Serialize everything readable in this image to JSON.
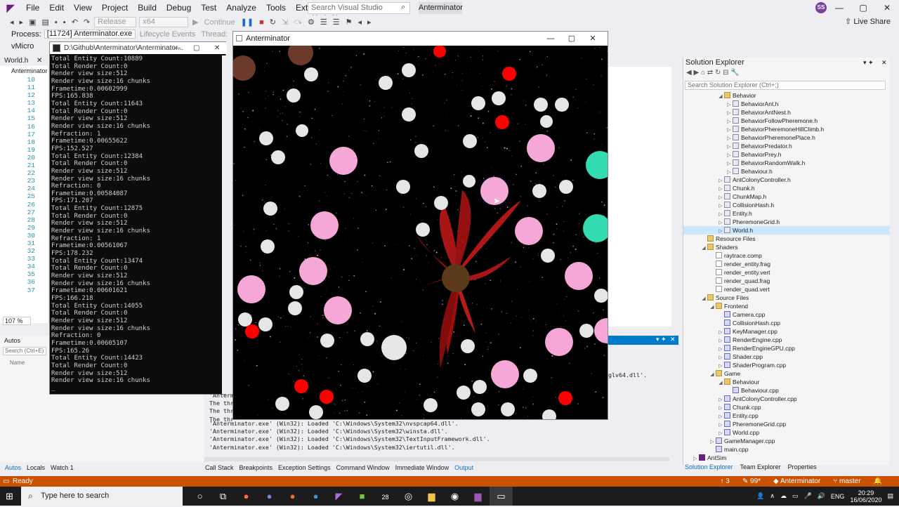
{
  "menu": {
    "items": [
      "File",
      "Edit",
      "View",
      "Project",
      "Build",
      "Debug",
      "Test",
      "Analyze",
      "Tools",
      "Extensions",
      "Window",
      "Help"
    ],
    "search_placeholder": "Search Visual Studio (Ctrl+Q)",
    "solution_name": "Anterminator",
    "avatar_initials": "SS"
  },
  "toolbar": {
    "config": "Release",
    "platform": "x64",
    "continue": "Continue",
    "live_share": "Live Share"
  },
  "process_bar": {
    "process_label": "Process:",
    "process_value": "[11724] Anterminator.exe",
    "lifecycle": "Lifecycle Events",
    "thread": "Thread:"
  },
  "editor": {
    "tab_micro": "vMicro",
    "file_tab": "World.h",
    "scope": "Anterminator",
    "line_numbers": [
      "10",
      "11",
      "12",
      "13",
      "14",
      "15",
      "16",
      "17",
      "18",
      "19",
      "20",
      "21",
      "22",
      "23",
      "24",
      "25",
      "26",
      "27",
      "28",
      "29",
      "30",
      "31",
      "32",
      "33",
      "34",
      "35",
      "36",
      "37"
    ],
    "zoom": "107 %"
  },
  "console": {
    "title": "D:\\Github\\Anterminator\\Anterminator...",
    "lines": [
      "Total Entity Count:10889",
      "Total Render Count:0",
      "Render view size:512",
      "Render view size:16 chunks",
      "Frametime:0.00602999",
      "FPS:165.838",
      "Total Entity Count:11643",
      "Total Render Count:0",
      "Render view size:512",
      "Render view size:16 chunks",
      "Refraction: 1",
      "Frametime:0.00655622",
      "FPS:152.527",
      "Total Entity Count:12384",
      "Total Render Count:0",
      "Render view size:512",
      "Render view size:16 chunks",
      "Refraction: 0",
      "Frametime:0.00584087",
      "FPS:171.207",
      "Total Entity Count:12875",
      "Total Render Count:0",
      "Render view size:512",
      "Render view size:16 chunks",
      "Refraction: 1",
      "Frametime:0.00561067",
      "FPS:178.232",
      "Total Entity Count:13474",
      "Total Render Count:0",
      "Render view size:512",
      "Render view size:16 chunks",
      "Frametime:0.00601621",
      "FPS:166.218",
      "Total Entity Count:14055",
      "Total Render Count:0",
      "Render view size:512",
      "Render view size:16 chunks",
      "Refraction: 0",
      "Frametime:0.00605107",
      "FPS:165.26",
      "Total Entity Count:14423",
      "Total Render Count:0",
      "Render view size:512",
      "Render view size:16 chunks"
    ]
  },
  "game_window": {
    "title": "Anterminator"
  },
  "autos": {
    "title": "Autos",
    "search": "Search (Ctrl+E)",
    "col_name": "Name"
  },
  "solution_explorer": {
    "title": "Solution Explorer",
    "search": "Search Solution Explorer (Ctrl+;)",
    "tree": [
      {
        "label": "Behavior",
        "kind": "fold",
        "indent": 4,
        "exp": "◢"
      },
      {
        "label": "BehaviorAnt.h",
        "kind": "h",
        "indent": 5,
        "exp": "▷"
      },
      {
        "label": "BehaviorAntNest.h",
        "kind": "h",
        "indent": 5,
        "exp": "▷"
      },
      {
        "label": "BehaviorFollowPheremone.h",
        "kind": "h",
        "indent": 5,
        "exp": "▷"
      },
      {
        "label": "BehaviorPheremoneHillClimb.h",
        "kind": "h",
        "indent": 5,
        "exp": "▷"
      },
      {
        "label": "BehaviorPheremonePlace.h",
        "kind": "h",
        "indent": 5,
        "exp": "▷"
      },
      {
        "label": "BehaviorPredator.h",
        "kind": "h",
        "indent": 5,
        "exp": "▷"
      },
      {
        "label": "BehaviorPrey.h",
        "kind": "h",
        "indent": 5,
        "exp": "▷"
      },
      {
        "label": "BehaviorRandomWalk.h",
        "kind": "h",
        "indent": 5,
        "exp": "▷"
      },
      {
        "label": "Behaviour.h",
        "kind": "h",
        "indent": 5,
        "exp": "▷"
      },
      {
        "label": "AntColonyController.h",
        "kind": "h",
        "indent": 4,
        "exp": "▷"
      },
      {
        "label": "Chunk.h",
        "kind": "h",
        "indent": 4,
        "exp": "▷"
      },
      {
        "label": "ChunkMap.h",
        "kind": "h",
        "indent": 4,
        "exp": "▷"
      },
      {
        "label": "CollisionHash.h",
        "kind": "h",
        "indent": 4,
        "exp": "▷"
      },
      {
        "label": "Entity.h",
        "kind": "h",
        "indent": 4,
        "exp": "▷"
      },
      {
        "label": "PheremoneGrid.h",
        "kind": "h",
        "indent": 4,
        "exp": "▷"
      },
      {
        "label": "World.h",
        "kind": "h",
        "indent": 4,
        "exp": "▷",
        "sel": true
      },
      {
        "label": "Resource Files",
        "kind": "fold",
        "indent": 2,
        "exp": ""
      },
      {
        "label": "Shaders",
        "kind": "fold",
        "indent": 2,
        "exp": "◢"
      },
      {
        "label": "raytrace.comp",
        "kind": "sh",
        "indent": 3,
        "exp": ""
      },
      {
        "label": "render_entity.frag",
        "kind": "sh",
        "indent": 3,
        "exp": ""
      },
      {
        "label": "render_entity.vert",
        "kind": "sh",
        "indent": 3,
        "exp": ""
      },
      {
        "label": "render_quad.frag",
        "kind": "sh",
        "indent": 3,
        "exp": ""
      },
      {
        "label": "render_quad.vert",
        "kind": "sh",
        "indent": 3,
        "exp": ""
      },
      {
        "label": "Source Files",
        "kind": "fold",
        "indent": 2,
        "exp": "◢"
      },
      {
        "label": "Frontend",
        "kind": "fold",
        "indent": 3,
        "exp": "◢"
      },
      {
        "label": "Camera.cpp",
        "kind": "cpp",
        "indent": 4,
        "exp": ""
      },
      {
        "label": "CollisionHash.cpp",
        "kind": "cpp",
        "indent": 4,
        "exp": ""
      },
      {
        "label": "KeyManager.cpp",
        "kind": "cpp",
        "indent": 4,
        "exp": "▷"
      },
      {
        "label": "RenderEngine.cpp",
        "kind": "cpp",
        "indent": 4,
        "exp": "▷"
      },
      {
        "label": "RenderEngineGPU.cpp",
        "kind": "cpp",
        "indent": 4,
        "exp": "▷"
      },
      {
        "label": "Shader.cpp",
        "kind": "cpp",
        "indent": 4,
        "exp": "▷"
      },
      {
        "label": "ShaderProgram.cpp",
        "kind": "cpp",
        "indent": 4,
        "exp": "▷"
      },
      {
        "label": "Game",
        "kind": "fold",
        "indent": 3,
        "exp": "◢"
      },
      {
        "label": "Behaviour",
        "kind": "fold",
        "indent": 4,
        "exp": "◢"
      },
      {
        "label": "Behaviour.cpp",
        "kind": "cpp",
        "indent": 5,
        "exp": ""
      },
      {
        "label": "AntColonyController.cpp",
        "kind": "cpp",
        "indent": 4,
        "exp": "▷"
      },
      {
        "label": "Chunk.cpp",
        "kind": "cpp",
        "indent": 4,
        "exp": "▷"
      },
      {
        "label": "Entity.cpp",
        "kind": "cpp",
        "indent": 4,
        "exp": "▷"
      },
      {
        "label": "PheremoneGrid.cpp",
        "kind": "cpp",
        "indent": 4,
        "exp": "▷"
      },
      {
        "label": "World.cpp",
        "kind": "cpp",
        "indent": 4,
        "exp": "▷"
      },
      {
        "label": "GameManager.cpp",
        "kind": "cpp",
        "indent": 3,
        "exp": "▷"
      },
      {
        "label": "main.cpp",
        "kind": "cpp",
        "indent": 3,
        "exp": ""
      },
      {
        "label": "AntSim",
        "kind": "proj",
        "indent": 1,
        "exp": "▷"
      }
    ],
    "tabs": [
      "Solution Explorer",
      "Team Explorer",
      "Properties"
    ]
  },
  "output": {
    "lines": [
      "'Anterminator.exe' (Win32): Loaded 'C:\\Windows\\System32\\nvspcap64.dll'.",
      "'Anterminator.exe' (Win32): Loaded 'C:\\Windows\\System32\\winsta.dll'.",
      "'Anterminator.exe' (Win32): Loaded 'C:\\Windows\\System32\\TextInputFramework.dll'.",
      "'Anterminator.exe' (Win32): Loaded 'C:\\Windows\\System32\\iertutil.dll'."
    ],
    "partial_lines": [
      "'Anterm",
      "The thr",
      "The thr",
      "The thr"
    ],
    "dll_fragment": "glv64.dll'."
  },
  "bottom_tabs_left": [
    "Autos",
    "Locals",
    "Watch 1"
  ],
  "bottom_tabs_mid": [
    "Call Stack",
    "Breakpoints",
    "Exception Settings",
    "Command Window",
    "Immediate Window",
    "Output"
  ],
  "status": {
    "ready": "Ready",
    "errors": "3",
    "warnings": "99*",
    "project": "Anterminator",
    "branch": "master"
  },
  "taskbar": {
    "search_placeholder": "Type here to search",
    "lang": "ENG",
    "time": "20:29",
    "date": "16/06/2020",
    "badge": "28"
  },
  "colors": {
    "accent": "#007acc",
    "status_bar": "#ca5100",
    "vs_purple": "#68217a",
    "food_red": "#ff0000",
    "white_ant": "#e6e6e6",
    "pink": "#f5a8d8",
    "teal": "#33dbb0",
    "nest_brown": "#5a3a1a"
  }
}
